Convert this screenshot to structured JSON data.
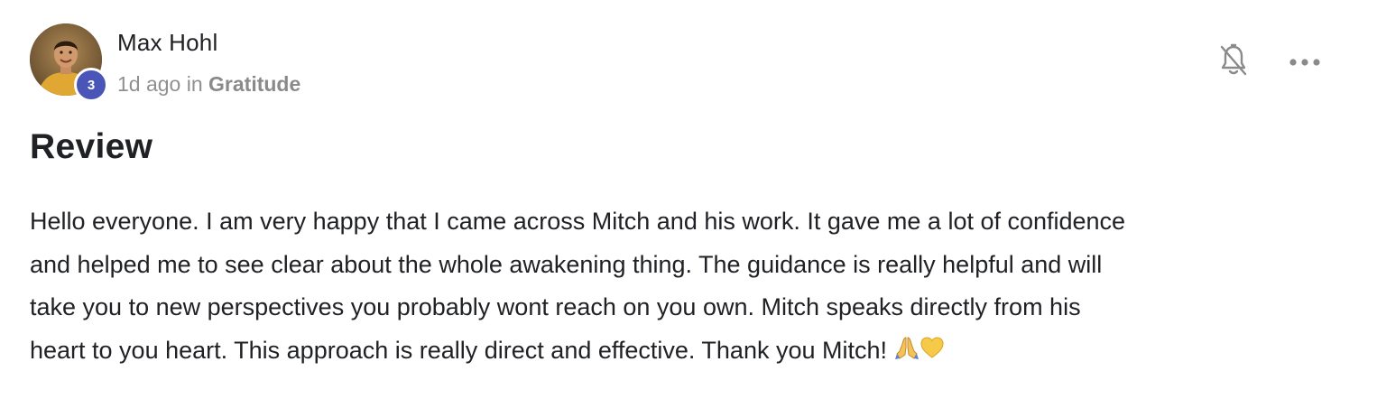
{
  "author": {
    "name": "Max Hohl",
    "level": "3"
  },
  "meta": {
    "time": "1d ago",
    "in_label": "in",
    "category": "Gratitude"
  },
  "post": {
    "title": "Review",
    "body_lines": [
      "Hello everyone. I am very happy that I came across Mitch and his work. It gave me a lot of confidence",
      "and helped me to see clear about the whole awakening thing. The guidance is really helpful and will",
      "take you to new perspectives you probably wont reach on you own. Mitch speaks directly from his",
      "heart to you heart. This approach is really direct and effective. Thank you Mitch! "
    ],
    "emojis": [
      "praying-hands-emoji",
      "yellow-heart-emoji"
    ]
  },
  "actions": {
    "bell_icon": "bell-off-icon",
    "more_icon": "more-horizontal-icon"
  },
  "colors": {
    "badge": "#4a55b8",
    "meta_text": "#909090",
    "text": "#202124",
    "icon": "#8a8a8a"
  }
}
